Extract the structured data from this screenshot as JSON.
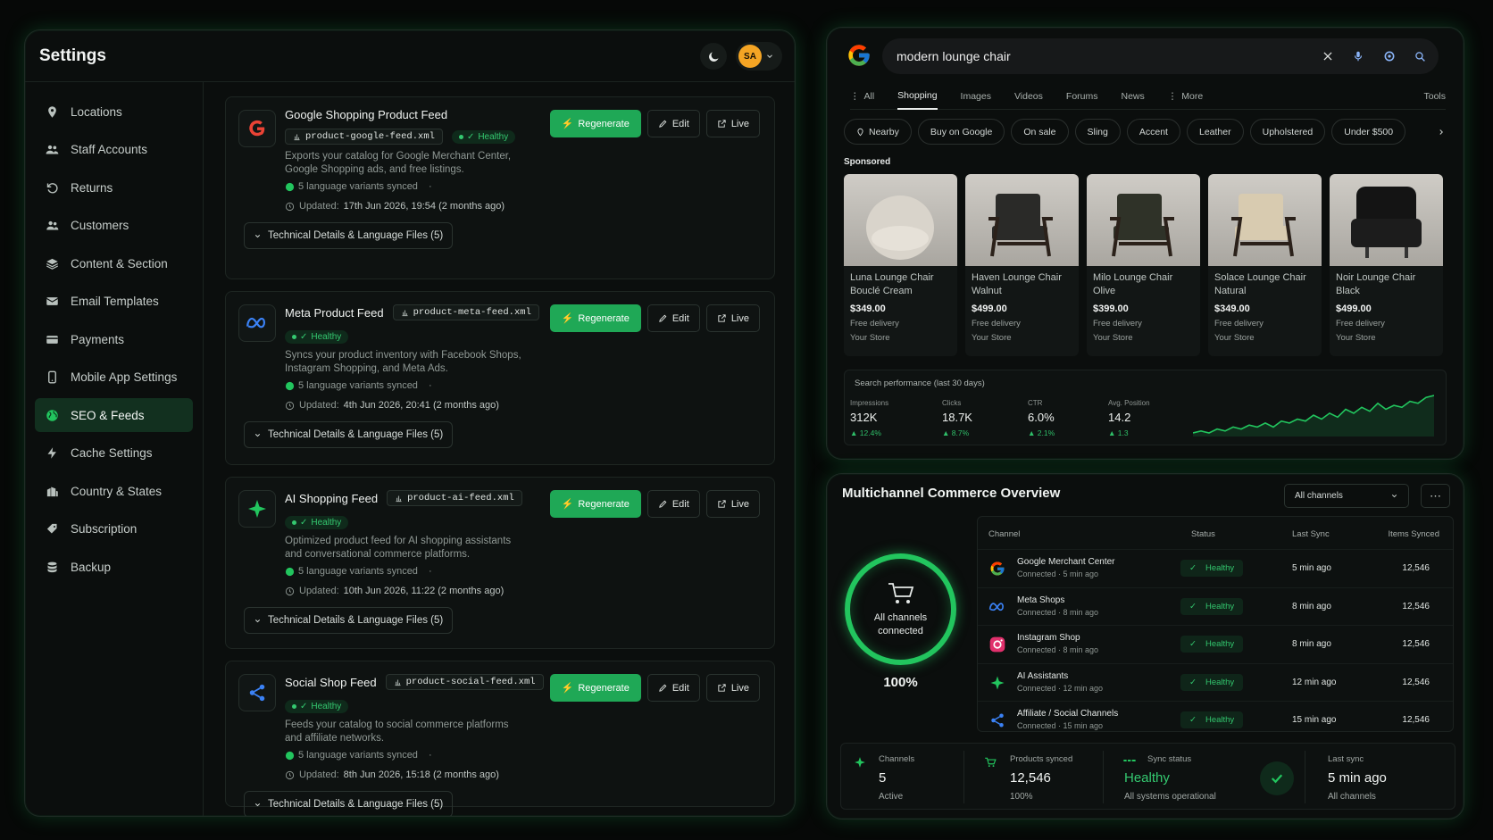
{
  "settings": {
    "title": "Settings",
    "avatar_initials": "SA",
    "nav": [
      {
        "label": "Locations",
        "icon": "location-pin-icon"
      },
      {
        "label": "Staff Accounts",
        "icon": "users-icon"
      },
      {
        "label": "Returns",
        "icon": "return-icon"
      },
      {
        "label": "Customers",
        "icon": "customers-icon"
      },
      {
        "label": "Content & Section",
        "icon": "layers-icon"
      },
      {
        "label": "Email Templates",
        "icon": "envelope-icon"
      },
      {
        "label": "Payments",
        "icon": "credit-card-icon"
      },
      {
        "label": "Mobile App Settings",
        "icon": "mobile-icon"
      },
      {
        "label": "SEO & Feeds",
        "icon": "globe-icon",
        "active": true
      },
      {
        "label": "Cache Settings",
        "icon": "bolt-icon"
      },
      {
        "label": "Country & States",
        "icon": "building-icon"
      },
      {
        "label": "Subscription",
        "icon": "tag-icon"
      },
      {
        "label": "Backup",
        "icon": "database-icon"
      }
    ],
    "feeds": [
      {
        "name": "Google Shopping Product Feed",
        "file": "product-google-feed.xml",
        "status": "Healthy",
        "desc": "Exports your catalog for Google Merchant Center, Google Shopping ads, and free listings.",
        "sync": "5 language variants synced",
        "updated_label": "Updated:",
        "updated": "17th Jun 2026, 19:54 (2 months ago)",
        "tech": "Technical Details & Language Files (5)"
      },
      {
        "name": "Meta Product Feed",
        "file": "product-meta-feed.xml",
        "status": "Healthy",
        "desc": "Syncs your product inventory with Facebook Shops, Instagram Shopping, and Meta Ads.",
        "sync": "5 language variants synced",
        "updated_label": "Updated:",
        "updated": "4th Jun 2026, 20:41 (2 months ago)",
        "tech": "Technical Details & Language Files (5)"
      },
      {
        "name": "AI Shopping Feed",
        "file": "product-ai-feed.xml",
        "status": "Healthy",
        "desc": "Optimized product feed for AI shopping assistants and conversational commerce platforms.",
        "sync": "5 language variants synced",
        "updated_label": "Updated:",
        "updated": "10th Jun 2026, 11:22 (2 months ago)",
        "tech": "Technical Details & Language Files (5)"
      },
      {
        "name": "Social Shop Feed",
        "file": "product-social-feed.xml",
        "status": "Healthy",
        "desc": "Feeds your catalog to social commerce platforms and affiliate networks.",
        "sync": "5 language variants synced",
        "updated_label": "Updated:",
        "updated": "8th Jun 2026, 15:18 (2 months ago)",
        "tech": "Technical Details & Language Files (5)"
      }
    ],
    "buttons": {
      "regenerate": "Regenerate",
      "edit": "Edit",
      "live": "Live"
    }
  },
  "google": {
    "query": "modern lounge chair",
    "tabs": [
      {
        "label": "All"
      },
      {
        "label": "Shopping",
        "active": true
      },
      {
        "label": "Images"
      },
      {
        "label": "Videos"
      },
      {
        "label": "Forums"
      },
      {
        "label": "News"
      },
      {
        "label": "More"
      }
    ],
    "tools": "Tools",
    "chips": [
      "Nearby",
      "Buy on Google",
      "On sale",
      "Sling",
      "Accent",
      "Leather",
      "Upholstered",
      "Under $500"
    ],
    "sponsored": "Sponsored",
    "products": [
      {
        "title": "Luna Lounge Chair Bouclé Cream",
        "price": "$349.00",
        "delivery": "Free delivery",
        "store": "Your Store",
        "color": "#d9d4cb"
      },
      {
        "title": "Haven Lounge Chair Walnut",
        "price": "$499.00",
        "delivery": "Free delivery",
        "store": "Your Store",
        "color": "#2a2a28"
      },
      {
        "title": "Milo Lounge Chair Olive",
        "price": "$399.00",
        "delivery": "Free delivery",
        "store": "Your Store",
        "color": "#2f3228"
      },
      {
        "title": "Solace Lounge Chair Natural",
        "price": "$349.00",
        "delivery": "Free delivery",
        "store": "Your Store",
        "color": "#d8cbb0"
      },
      {
        "title": "Noir Lounge Chair Black",
        "price": "$499.00",
        "delivery": "Free delivery",
        "store": "Your Store",
        "color": "#141414"
      }
    ],
    "performance": {
      "title": "Search performance (last 30 days)",
      "metrics": [
        {
          "label": "Impressions",
          "value": "312K",
          "change": "12.4%"
        },
        {
          "label": "Clicks",
          "value": "18.7K",
          "change": "8.7%"
        },
        {
          "label": "CTR",
          "value": "6.0%",
          "change": "2.1%"
        },
        {
          "label": "Avg. Position",
          "value": "14.2",
          "change": "1.3"
        }
      ],
      "sparkline": [
        3,
        4,
        3,
        5,
        4,
        6,
        5,
        7,
        6,
        8,
        6,
        9,
        8,
        10,
        9,
        12,
        10,
        13,
        11,
        15,
        13,
        16,
        14,
        18,
        15,
        17,
        16,
        19,
        18,
        21,
        22
      ]
    }
  },
  "mco": {
    "title": "Multichannel Commerce Overview",
    "filter": "All channels",
    "ring_text": "All channels connected",
    "ring_pct": "100%",
    "ring_value": 100,
    "headers": {
      "channel": "Channel",
      "status": "Status",
      "last_sync": "Last Sync",
      "items": "Items Synced"
    },
    "channels": [
      {
        "name": "Google Merchant Center",
        "conn": "Connected · 5 min ago",
        "status": "Healthy",
        "sync": "5 min ago",
        "items": "12,546",
        "icon": "google-icon"
      },
      {
        "name": "Meta Shops",
        "conn": "Connected · 8 min ago",
        "status": "Healthy",
        "sync": "8 min ago",
        "items": "12,546",
        "icon": "meta-icon"
      },
      {
        "name": "Instagram Shop",
        "conn": "Connected · 8 min ago",
        "status": "Healthy",
        "sync": "8 min ago",
        "items": "12,546",
        "icon": "instagram-icon"
      },
      {
        "name": "AI Assistants",
        "conn": "Connected · 12 min ago",
        "status": "Healthy",
        "sync": "12 min ago",
        "items": "12,546",
        "icon": "sparkle-icon"
      },
      {
        "name": "Affiliate / Social Channels",
        "conn": "Connected · 15 min ago",
        "status": "Healthy",
        "sync": "15 min ago",
        "items": "12,546",
        "icon": "share-icon"
      }
    ],
    "stats": {
      "channels": {
        "label": "Channels",
        "value": "5",
        "sub": "Active"
      },
      "products": {
        "label": "Products synced",
        "value": "12,546",
        "sub": "100%"
      },
      "sync": {
        "label": "Sync status",
        "value": "Healthy",
        "sub": "All systems operational"
      },
      "last": {
        "label": "Last sync",
        "value": "5 min ago",
        "sub": "All channels"
      }
    }
  },
  "colors": {
    "accent": "#22c55e",
    "button": "#1fa856"
  }
}
